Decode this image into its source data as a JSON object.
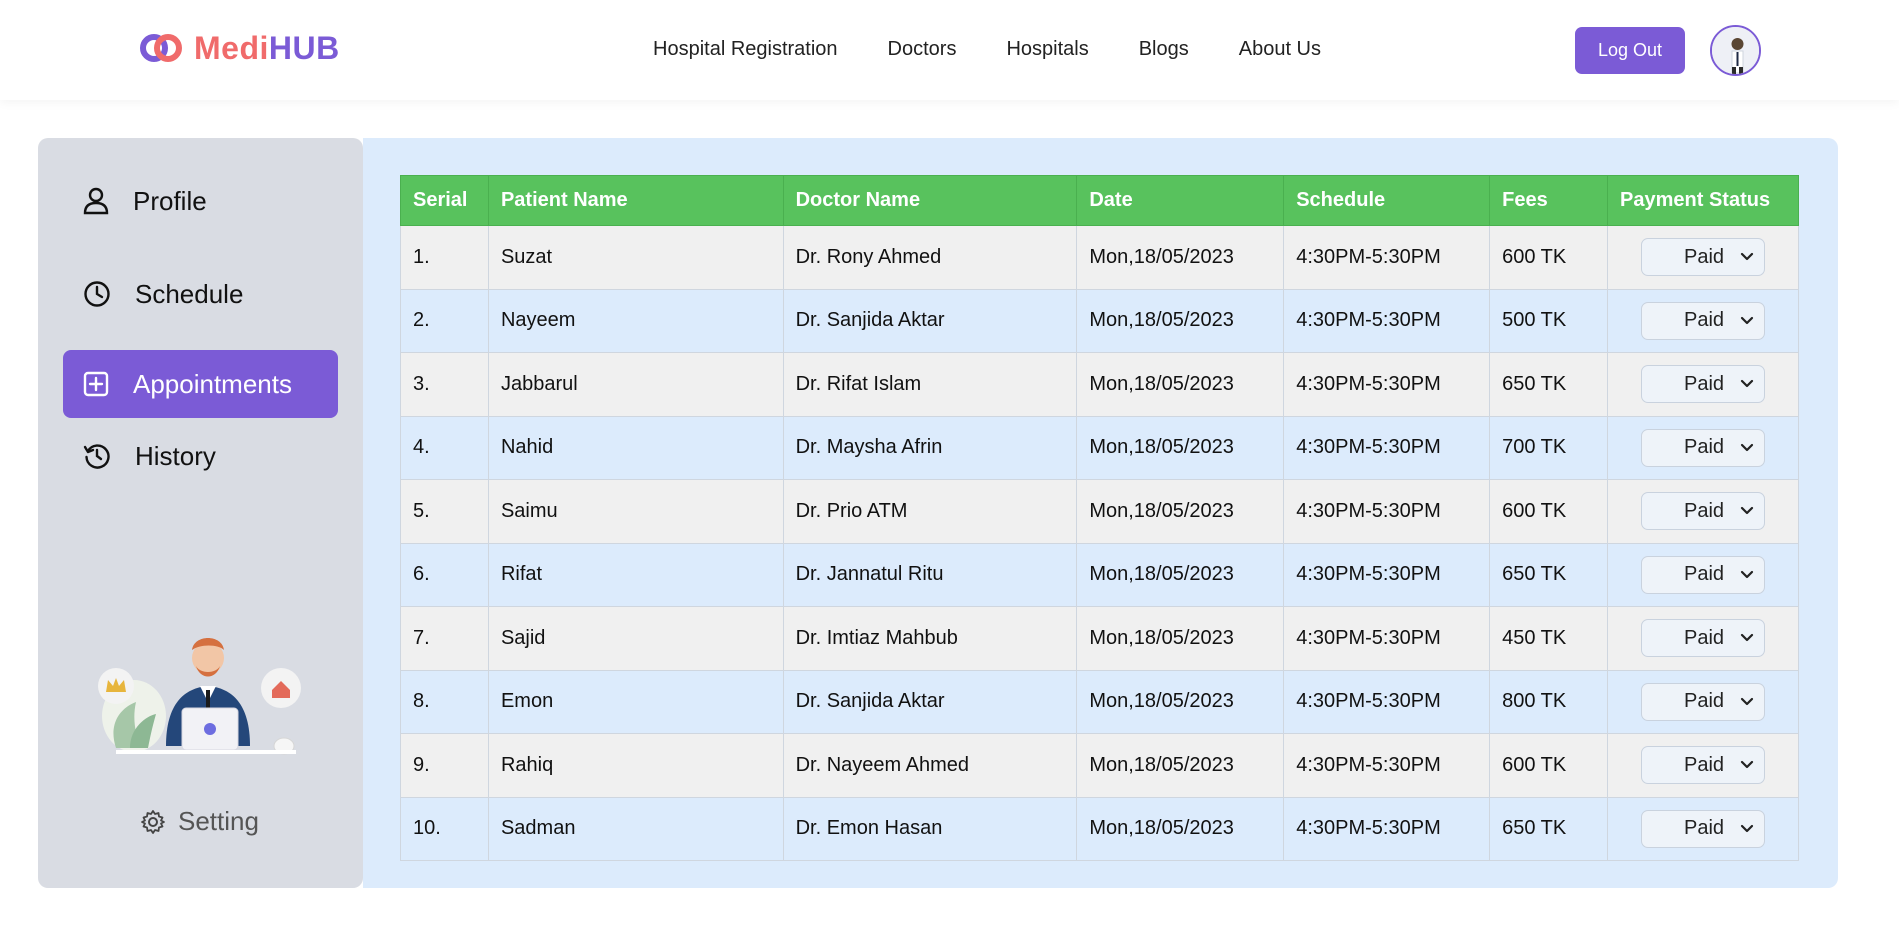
{
  "brand": {
    "name_part1": "Medi",
    "name_part2": "HUB"
  },
  "nav": [
    {
      "label": "Hospital Registration"
    },
    {
      "label": "Doctors"
    },
    {
      "label": "Hospitals"
    },
    {
      "label": "Blogs"
    },
    {
      "label": "About Us"
    }
  ],
  "header": {
    "logout_label": "Log Out",
    "avatar_icon": "user-avatar"
  },
  "sidebar": {
    "items": [
      {
        "label": "Profile",
        "icon": "user-icon",
        "active": false
      },
      {
        "label": "Schedule",
        "icon": "clock-icon",
        "active": false
      },
      {
        "label": "Appointments",
        "icon": "plus-square-icon",
        "active": true
      },
      {
        "label": "History",
        "icon": "history-icon",
        "active": false
      }
    ],
    "setting_label": "Setting"
  },
  "table": {
    "columns": [
      "Serial",
      "Patient Name",
      "Doctor Name",
      "Date",
      "Schedule",
      "Fees",
      "Payment Status"
    ],
    "rows": [
      {
        "serial": "1.",
        "patient": "Suzat",
        "doctor": "Dr. Rony Ahmed",
        "date": "Mon,18/05/2023",
        "schedule": "4:30PM-5:30PM",
        "fees": "600 TK",
        "status": "Paid"
      },
      {
        "serial": "2.",
        "patient": "Nayeem",
        "doctor": "Dr. Sanjida Aktar",
        "date": "Mon,18/05/2023",
        "schedule": "4:30PM-5:30PM",
        "fees": "500 TK",
        "status": "Paid"
      },
      {
        "serial": "3.",
        "patient": "Jabbarul",
        "doctor": "Dr. Rifat Islam",
        "date": "Mon,18/05/2023",
        "schedule": "4:30PM-5:30PM",
        "fees": "650 TK",
        "status": "Paid"
      },
      {
        "serial": "4.",
        "patient": "Nahid",
        "doctor": "Dr. Maysha Afrin",
        "date": "Mon,18/05/2023",
        "schedule": "4:30PM-5:30PM",
        "fees": "700 TK",
        "status": "Paid"
      },
      {
        "serial": "5.",
        "patient": "Saimu",
        "doctor": "Dr. Prio ATM",
        "date": "Mon,18/05/2023",
        "schedule": "4:30PM-5:30PM",
        "fees": "600 TK",
        "status": "Paid"
      },
      {
        "serial": "6.",
        "patient": "Rifat",
        "doctor": "Dr. Jannatul Ritu",
        "date": "Mon,18/05/2023",
        "schedule": "4:30PM-5:30PM",
        "fees": "650 TK",
        "status": "Paid"
      },
      {
        "serial": "7.",
        "patient": "Sajid",
        "doctor": "Dr. Imtiaz Mahbub",
        "date": "Mon,18/05/2023",
        "schedule": "4:30PM-5:30PM",
        "fees": "450 TK",
        "status": "Paid"
      },
      {
        "serial": "8.",
        "patient": "Emon",
        "doctor": "Dr. Sanjida Aktar",
        "date": "Mon,18/05/2023",
        "schedule": "4:30PM-5:30PM",
        "fees": "800 TK",
        "status": "Paid"
      },
      {
        "serial": "9.",
        "patient": "Rahiq",
        "doctor": "Dr. Nayeem Ahmed",
        "date": "Mon,18/05/2023",
        "schedule": "4:30PM-5:30PM",
        "fees": "600 TK",
        "status": "Paid"
      },
      {
        "serial": "10.",
        "patient": "Sadman",
        "doctor": "Dr. Emon Hasan",
        "date": "Mon,18/05/2023",
        "schedule": "4:30PM-5:30PM",
        "fees": "650 TK",
        "status": "Paid"
      }
    ]
  },
  "colors": {
    "accent": "#7b5bd6",
    "brand_red": "#f06b6b",
    "table_header": "#58c25d",
    "main_bg": "#dcebfc",
    "sidebar_bg": "#d9dce3"
  }
}
